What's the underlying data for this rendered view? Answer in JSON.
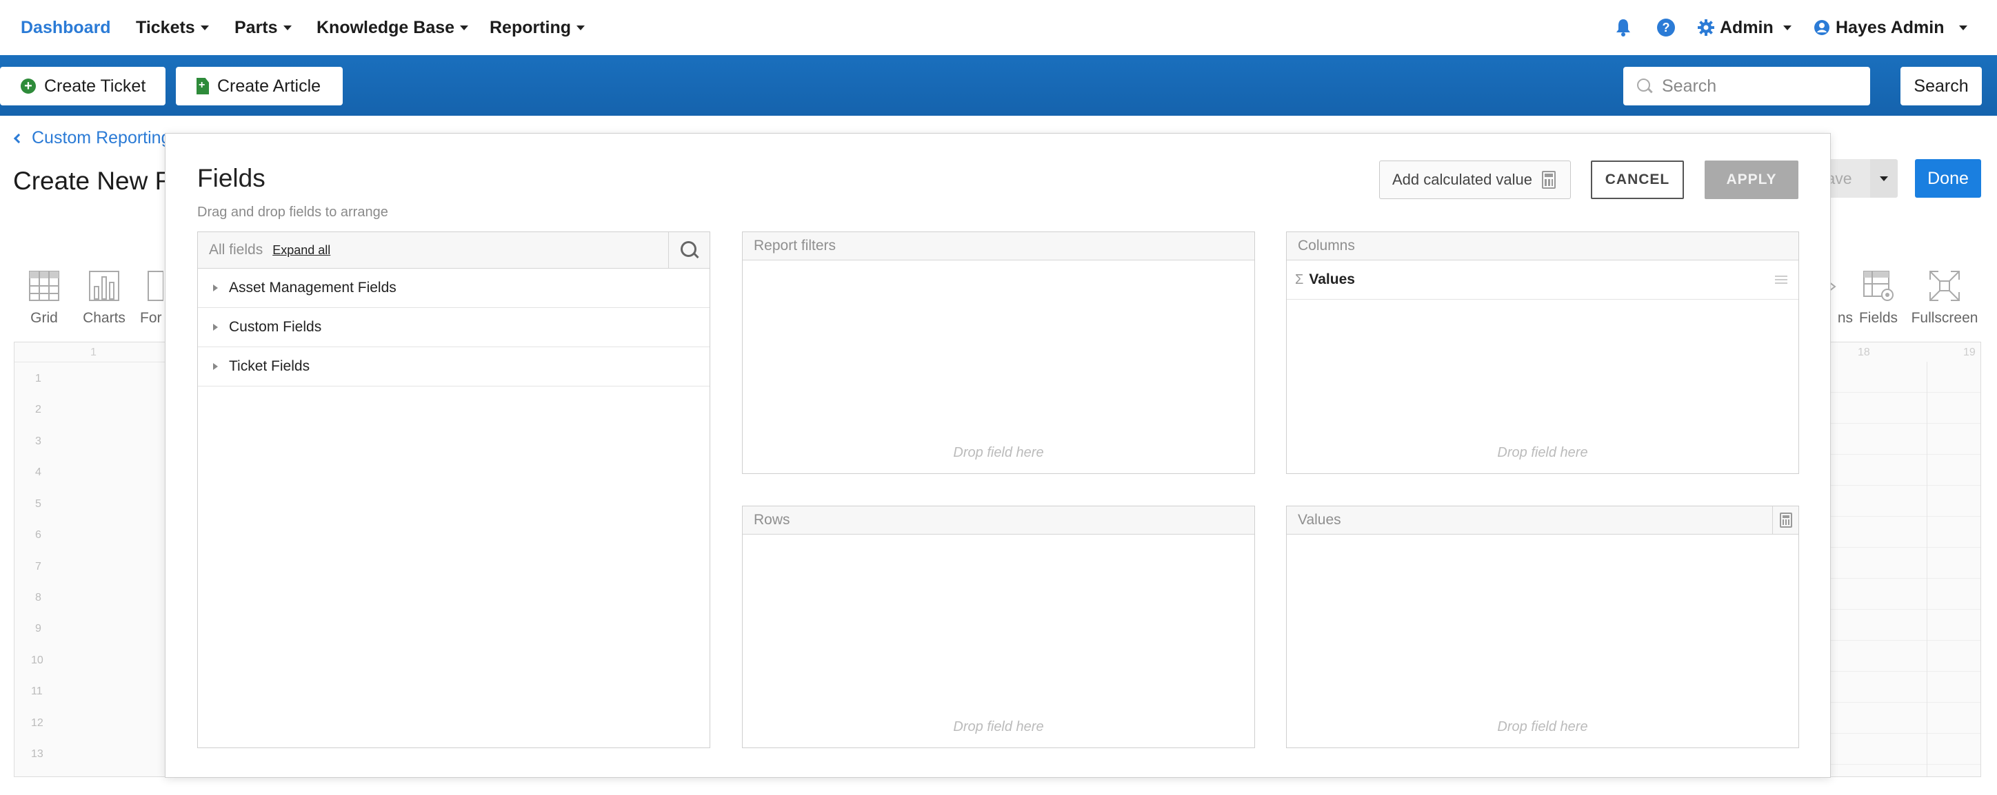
{
  "nav": {
    "brand": "Dashboard",
    "menus": [
      {
        "label": "Tickets"
      },
      {
        "label": "Parts"
      },
      {
        "label": "Knowledge Base"
      },
      {
        "label": "Reporting"
      }
    ],
    "bell_icon": "bell-icon",
    "help_icon": "question-icon",
    "admin_menu": "Admin",
    "user_menu": "Hayes Admin"
  },
  "actionbar": {
    "create_ticket": "Create Ticket",
    "create_article": "Create Article",
    "search_placeholder": "Search",
    "search_button": "Search"
  },
  "page": {
    "breadcrumb": "Custom Reporting",
    "title": "Create New R",
    "save_label": "ave",
    "done_label": "Done",
    "toolbar_left": [
      {
        "label": "Grid",
        "icon": "grid-icon"
      },
      {
        "label": "Charts",
        "icon": "chart-icon"
      },
      {
        "label": "For",
        "icon": "format-icon"
      }
    ],
    "toolbar_right": [
      {
        "label": "ns",
        "icon": "options-icon"
      },
      {
        "label": "Fields",
        "icon": "fields-icon"
      },
      {
        "label": "Fullscreen",
        "icon": "fullscreen-icon"
      }
    ],
    "grid_col_labels": [
      "1",
      "18",
      "19"
    ],
    "row_numbers": [
      "1",
      "2",
      "3",
      "4",
      "5",
      "6",
      "7",
      "8",
      "9",
      "10",
      "11",
      "12",
      "13"
    ]
  },
  "modal": {
    "title": "Fields",
    "subtitle": "Drag and drop fields to arrange",
    "add_calculated": "Add calculated value",
    "cancel": "CANCEL",
    "apply": "APPLY",
    "all_fields": {
      "title": "All fields",
      "expand_all": "Expand all",
      "items": [
        {
          "label": "Asset Management Fields"
        },
        {
          "label": "Custom Fields"
        },
        {
          "label": "Ticket Fields"
        }
      ]
    },
    "report_filters": {
      "title": "Report filters",
      "hint": "Drop field here"
    },
    "columns": {
      "title": "Columns",
      "items": [
        {
          "label": "Values"
        }
      ],
      "hint": "Drop field here"
    },
    "rows": {
      "title": "Rows",
      "hint": "Drop field here"
    },
    "values": {
      "title": "Values",
      "hint": "Drop field here"
    }
  },
  "colors": {
    "brand_blue": "#2b7bd6",
    "actionbar_blue": "#1667b3",
    "green_icon": "#2e8b3a",
    "done_blue": "#1a7fe0",
    "apply_disabled": "#aaaaaa"
  }
}
